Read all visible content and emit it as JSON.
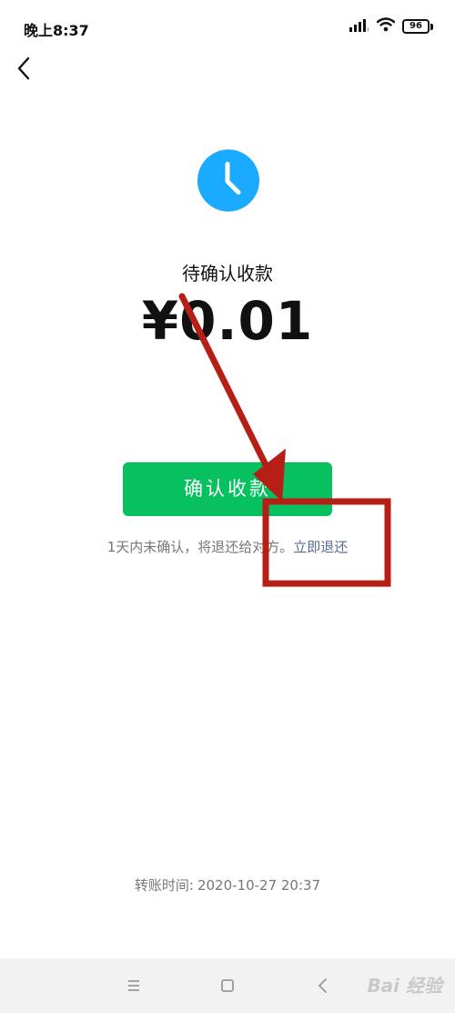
{
  "status_bar": {
    "time": "晚上8:37",
    "battery": "96",
    "icons": [
      "signal-icon",
      "wifi-icon",
      "battery-icon"
    ]
  },
  "nav": {
    "back_icon": "chevron-left-icon"
  },
  "payment": {
    "status_icon": "clock-icon",
    "status_title": "待确认收款",
    "amount": "¥0.01",
    "confirm_button": "确认收款",
    "notice_text": "1天内未确认，将退还给对方。",
    "return_link": "立即退还",
    "transfer_time_label": "转账时间:",
    "transfer_time_value": "2020-10-27 20:37"
  },
  "system_nav": {
    "icons": [
      "menu-icon",
      "home-icon",
      "back-icon"
    ],
    "watermark": "Bai 经验"
  },
  "colors": {
    "accent_green": "#07c160",
    "link_blue": "#576b95",
    "clock_blue": "#1aaaff",
    "annotation_red": "#b51f16"
  }
}
